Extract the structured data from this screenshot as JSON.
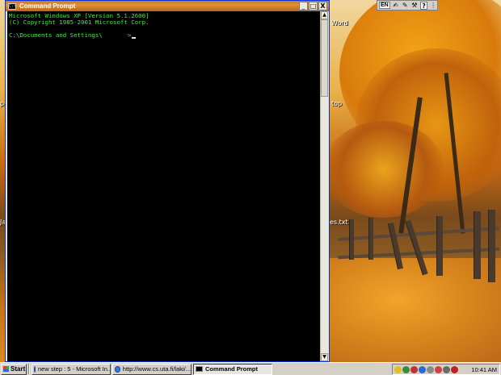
{
  "window": {
    "title": "Command Prompt",
    "minimize": "_",
    "maximize": "□",
    "close": "X",
    "icon_text": "C:\\"
  },
  "console": {
    "line1": "Microsoft Windows XP [Version 5.1.2600]",
    "line2": "(C) Copyright 1985-2001 Microsoft Corp.",
    "prompt": "C:\\Documents and Settings\\       >"
  },
  "scrollbar": {
    "up": "▲",
    "down": "▼"
  },
  "desktop_icons": {
    "word": "Word",
    "top": "top",
    "txt": "es.txt",
    "pe": "pe",
    "ja": "Ja"
  },
  "langbar": {
    "language": "EN",
    "help": "?"
  },
  "taskbar": {
    "start": "Start",
    "tasks": [
      {
        "label": "new step : 5 - Microsoft In..."
      },
      {
        "label": "http://www.cs.uta.fi/laki/..."
      },
      {
        "label": "Command Prompt"
      }
    ],
    "clock": "10:41 AM"
  },
  "colors": {
    "console_text": "#2ef52e",
    "console_bg": "#000000",
    "titlebar": "#c77a2a"
  }
}
